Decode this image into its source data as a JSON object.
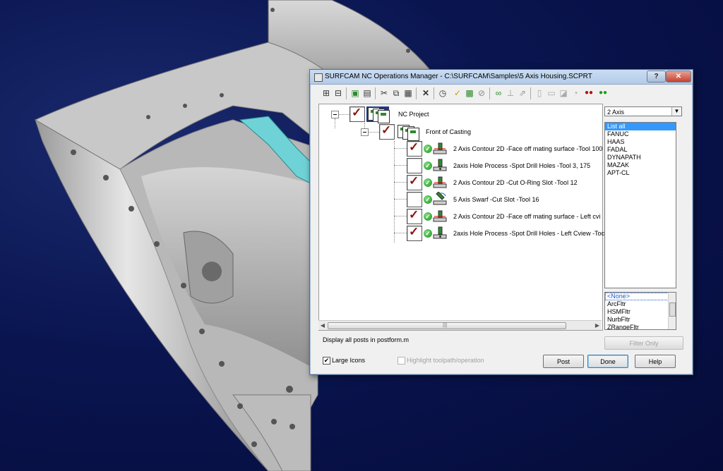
{
  "window": {
    "title": "SURFCAM NC Operations Manager - C:\\SURFCAM\\Samples\\5 Axis Housing.SCPRT",
    "help_label": "?",
    "close_label": "✕"
  },
  "toolbar": {
    "icons": [
      "add-icon",
      "remove-icon",
      "copy-ops-icon",
      "paste-ops-icon",
      "cut-icon",
      "copy-icon",
      "paste-icon",
      "delete-icon",
      "timer-icon",
      "check-edit-icon",
      "regenerate-icon",
      "disable-icon",
      "glasses-icon",
      "tool-icon",
      "post-icon",
      "page-icon",
      "page-edit-icon",
      "toolpath-icon",
      "simulate-icon",
      "red-dots-icon",
      "green-dots-icon"
    ]
  },
  "tree": {
    "root_label": "NC Project",
    "group_label": "Front of Casting",
    "operations": [
      {
        "label": "2 Axis Contour 2D  -Face off mating surface -Tool 100",
        "checked": true
      },
      {
        "label": "2axis Hole Process  -Spot Drill Holes -Tool 3, 175",
        "checked": false
      },
      {
        "label": "2 Axis Contour 2D  -Cut O-Ring Slot -Tool 12",
        "checked": true
      },
      {
        "label": "5 Axis Swarf  -Cut Slot -Tool 16",
        "checked": false
      },
      {
        "label": "2 Axis Contour 2D  -Face off mating surface - Left cvi",
        "checked": true
      },
      {
        "label": "2axis Hole Process  -Spot Drill Holes - Left Cview -Toc",
        "checked": true
      }
    ]
  },
  "status": {
    "text": "Display all posts in postform.m"
  },
  "options": {
    "large_icons_label": "Large Icons",
    "large_icons_checked": "✔",
    "highlight_label": "Highlight toolpath/operation"
  },
  "posts": {
    "axis_select": "2 Axis",
    "machines": [
      "List all",
      "FANUC",
      "HAAS",
      "FADAL",
      "DYNAPATH",
      "MAZAK",
      "APT-CL"
    ],
    "filters": [
      "<None>",
      "ArcFltr",
      "HSMFltr",
      "NurbFltr",
      "ZRangeFltr"
    ],
    "filter_only_label": "Filter Only"
  },
  "buttons": {
    "post": "Post",
    "done": "Done",
    "help": "Help"
  },
  "colors": {
    "accent_select": "#3399ff",
    "check_mark": "#8b1414",
    "status_ok": "#1f8f1f"
  }
}
